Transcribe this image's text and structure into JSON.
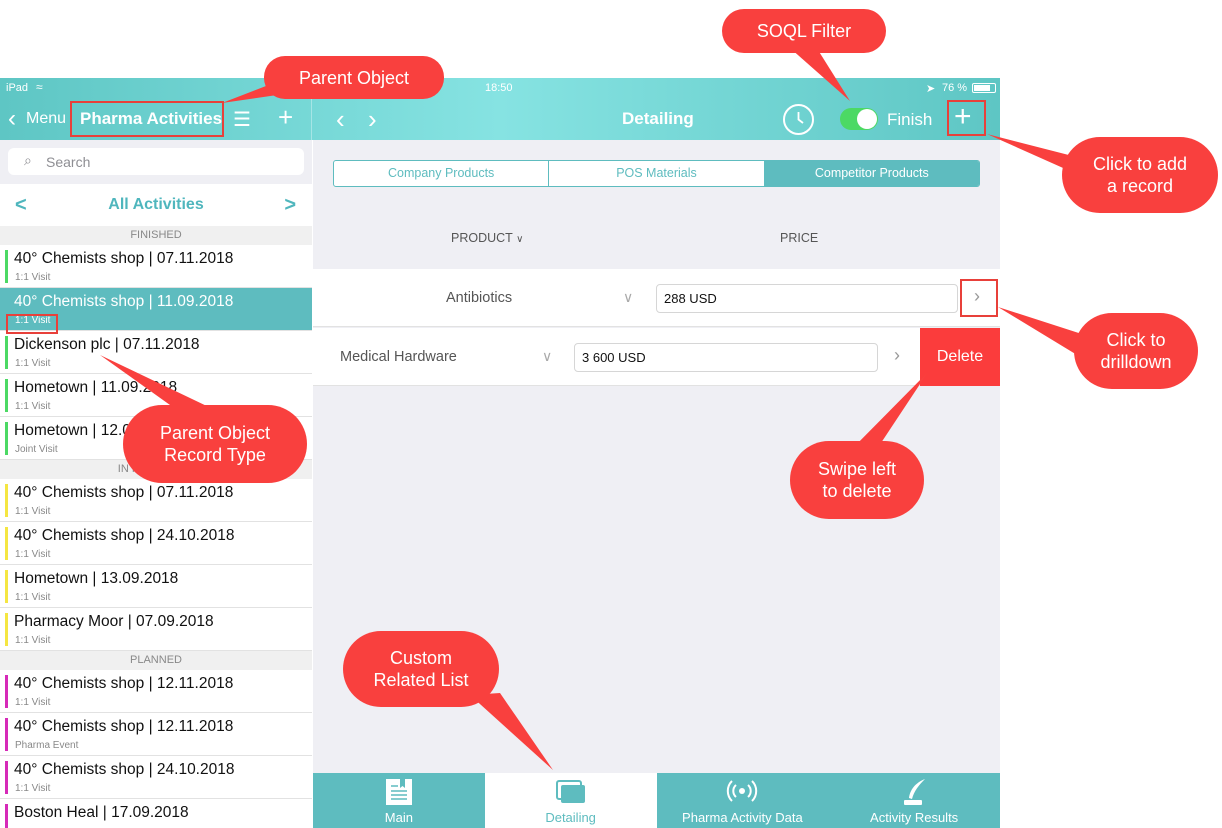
{
  "colors": {
    "accent": "#5ebcbf",
    "callout": "#f9403e",
    "finished": "#4cd964",
    "in_progress": "#f5e642",
    "planned": "#d62ab8"
  },
  "statusbar": {
    "device": "iPad",
    "time": "18:50",
    "battery": "76 %"
  },
  "navbar": {
    "back_label": "Menu",
    "title": "Pharma Activities",
    "detail_title": "Detailing",
    "finish_label": "Finish",
    "finish_on": true
  },
  "search": {
    "placeholder": "Search"
  },
  "list": {
    "title": "All Activities",
    "prev": "<",
    "next": ">",
    "sections": [
      {
        "header": "FINISHED",
        "color": "#4cd964",
        "rows": [
          {
            "title": "40° Chemists shop | 07.11.2018",
            "sub": "1:1 Visit"
          },
          {
            "title": "40° Chemists shop | 11.09.2018",
            "sub": "1:1 Visit",
            "selected": true
          },
          {
            "title": "Dickenson plc | 07.11.2018",
            "sub": "1:1 Visit"
          },
          {
            "title": "Hometown | 11.09.2018",
            "sub": "1:1 Visit"
          },
          {
            "title": "Hometown | 12.09.2018",
            "sub": "Joint Visit"
          }
        ]
      },
      {
        "header": "IN PROGRESS",
        "color": "#f5e642",
        "rows": [
          {
            "title": "40° Chemists shop | 07.11.2018",
            "sub": "1:1 Visit"
          },
          {
            "title": "40° Chemists shop | 24.10.2018",
            "sub": "1:1 Visit"
          },
          {
            "title": "Hometown | 13.09.2018",
            "sub": "1:1 Visit"
          },
          {
            "title": "Pharmacy Moor | 07.09.2018",
            "sub": "1:1 Visit"
          }
        ]
      },
      {
        "header": "PLANNED",
        "color": "#d62ab8",
        "rows": [
          {
            "title": "40° Chemists shop | 12.11.2018",
            "sub": "1:1 Visit"
          },
          {
            "title": "40° Chemists shop | 12.11.2018",
            "sub": "Pharma Event"
          },
          {
            "title": "40° Chemists shop | 24.10.2018",
            "sub": "1:1 Visit"
          },
          {
            "title": "Boston Heal | 17.09.2018",
            "sub": ""
          }
        ]
      }
    ]
  },
  "segments": [
    "Company Products",
    "POS Materials",
    "Competitor Products"
  ],
  "columns": {
    "product": "PRODUCT",
    "price": "PRICE"
  },
  "products": [
    {
      "name": "Antibiotics",
      "price": "288 USD"
    },
    {
      "name": "Medical Hardware",
      "price": "3 600 USD",
      "delete_label": "Delete"
    }
  ],
  "tabs": [
    {
      "label": "Main",
      "icon": "book-icon"
    },
    {
      "label": "Detailing",
      "icon": "stack-icon",
      "active": true
    },
    {
      "label": "Pharma Activity Data",
      "icon": "signal-icon"
    },
    {
      "label": "Activity Results",
      "icon": "quill-icon"
    }
  ],
  "callouts": {
    "parent_object": "Parent Object",
    "soql_filter": "SOQL Filter",
    "add_record": [
      "Click to add",
      "a record"
    ],
    "drilldown": [
      "Click to",
      "drilldown"
    ],
    "record_type": [
      "Parent Object",
      "Record Type"
    ],
    "swipe_delete": [
      "Swipe left",
      "to delete"
    ],
    "custom_related": [
      "Custom",
      "Related List"
    ]
  }
}
